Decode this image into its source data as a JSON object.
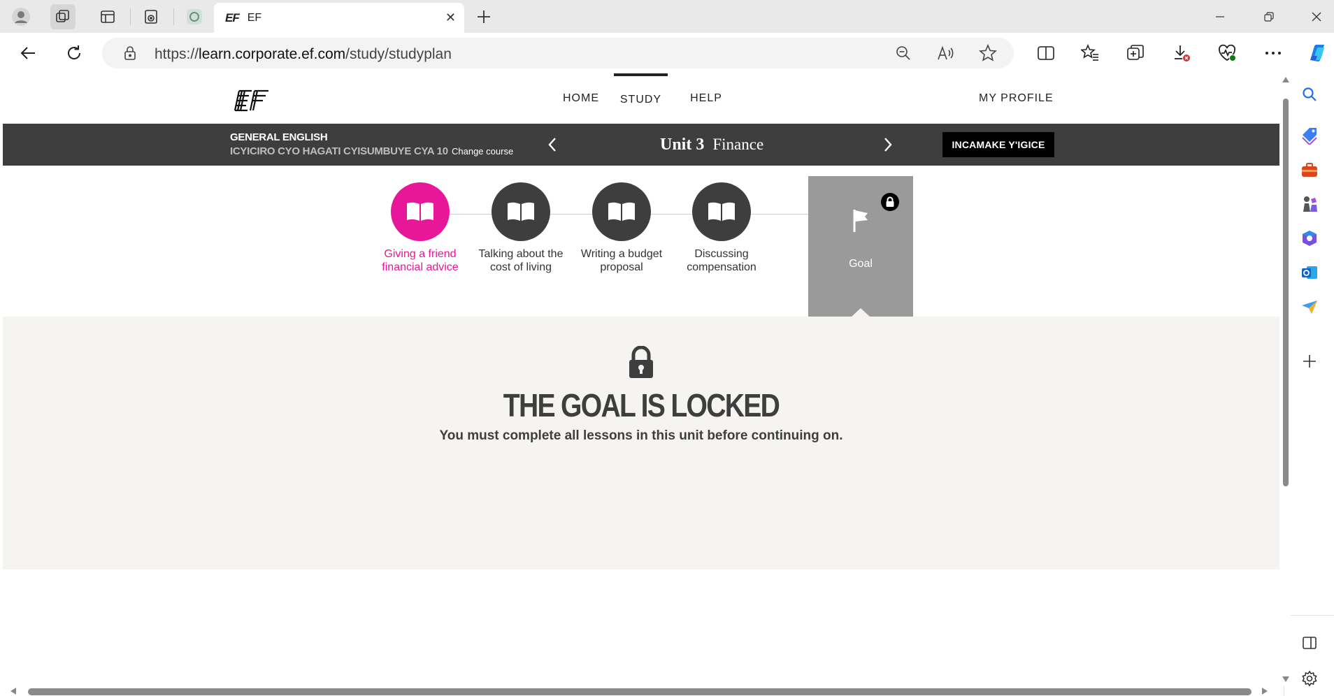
{
  "browser": {
    "tab": {
      "logo": "EF",
      "title": "EF",
      "close": "✕"
    },
    "new_tab": "+",
    "url": {
      "scheme": "https://",
      "host": "learn.corporate.ef.com",
      "path": "/study/studyplan"
    }
  },
  "site": {
    "nav": {
      "home": "HOME",
      "study": "STUDY",
      "help": "HELP",
      "profile": "MY PROFILE"
    }
  },
  "course": {
    "name": "GENERAL ENGLISH",
    "level": "ICYICIRO CYO HAGATI CYISUMBUYE CYA 10",
    "change": "Change course",
    "unit_word": "Unit 3",
    "unit_name": "Finance",
    "review_button": "INCAMAKE Y'IGICE"
  },
  "lessons": [
    {
      "label": "Giving a friend financial advice",
      "active": true
    },
    {
      "label": "Talking about the cost of living",
      "active": false
    },
    {
      "label": "Writing a budget proposal",
      "active": false
    },
    {
      "label": "Discussing compensation",
      "active": false
    }
  ],
  "goal": {
    "label": "Goal",
    "locked": true
  },
  "locked": {
    "title": "THE GOAL IS LOCKED",
    "message": "You must complete all lessons in this unit before continuing on."
  },
  "colors": {
    "accent": "#e8179a",
    "dark": "#3e3e3e",
    "goal": "#9a9a9a",
    "locked_bg": "#f6f4f0"
  },
  "icons": [
    "profile-icon",
    "workspaces-icon",
    "tab-actions-icon",
    "collections-tab-icon",
    "chatgpt-tab-icon",
    "back-icon",
    "refresh-icon",
    "lock-icon",
    "zoom-out-icon",
    "read-aloud-icon",
    "favorite-icon",
    "split-screen-icon",
    "favorites-icon",
    "collections-icon",
    "downloads-icon",
    "health-icon",
    "more-icon",
    "copilot-icon",
    "search-icon",
    "shopping-icon",
    "tools-icon",
    "games-icon",
    "office-icon",
    "outlook-icon",
    "send-icon",
    "add-icon",
    "sidebar-icon",
    "settings-icon"
  ]
}
